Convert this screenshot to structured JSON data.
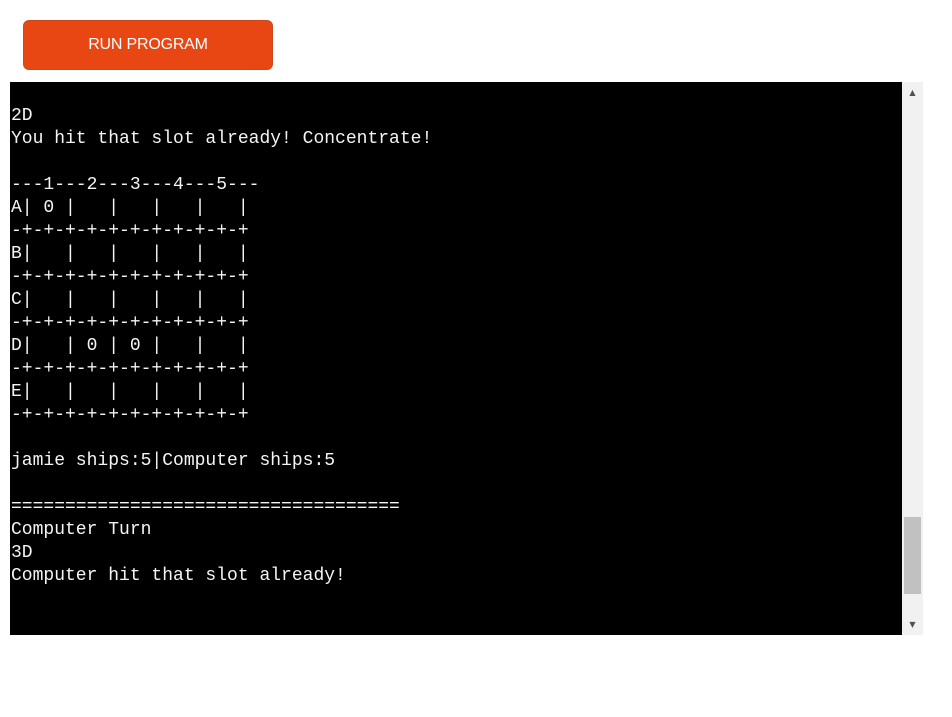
{
  "toolbar": {
    "run_label": "RUN PROGRAM"
  },
  "terminal": {
    "lines": [
      "2D",
      "You hit that slot already! Concentrate!",
      "",
      "---1---2---3---4---5---",
      "A| 0 |   |   |   |   |",
      "-+-+-+-+-+-+-+-+-+-+-+",
      "B|   |   |   |   |   |",
      "-+-+-+-+-+-+-+-+-+-+-+",
      "C|   |   |   |   |   |",
      "-+-+-+-+-+-+-+-+-+-+-+",
      "D|   | 0 | 0 |   |   |",
      "-+-+-+-+-+-+-+-+-+-+-+",
      "E|   |   |   |   |   |",
      "-+-+-+-+-+-+-+-+-+-+-+",
      "",
      "jamie ships:5|Computer ships:5",
      "",
      "====================================",
      "Computer Turn",
      "3D",
      "Computer hit that slot already!"
    ]
  },
  "scrollbar": {
    "up_icon": "▲",
    "down_icon": "▼",
    "position": 0.9
  },
  "colors": {
    "button": "#e84613",
    "terminal_bg": "#000000",
    "terminal_fg": "#f4f4f4"
  }
}
